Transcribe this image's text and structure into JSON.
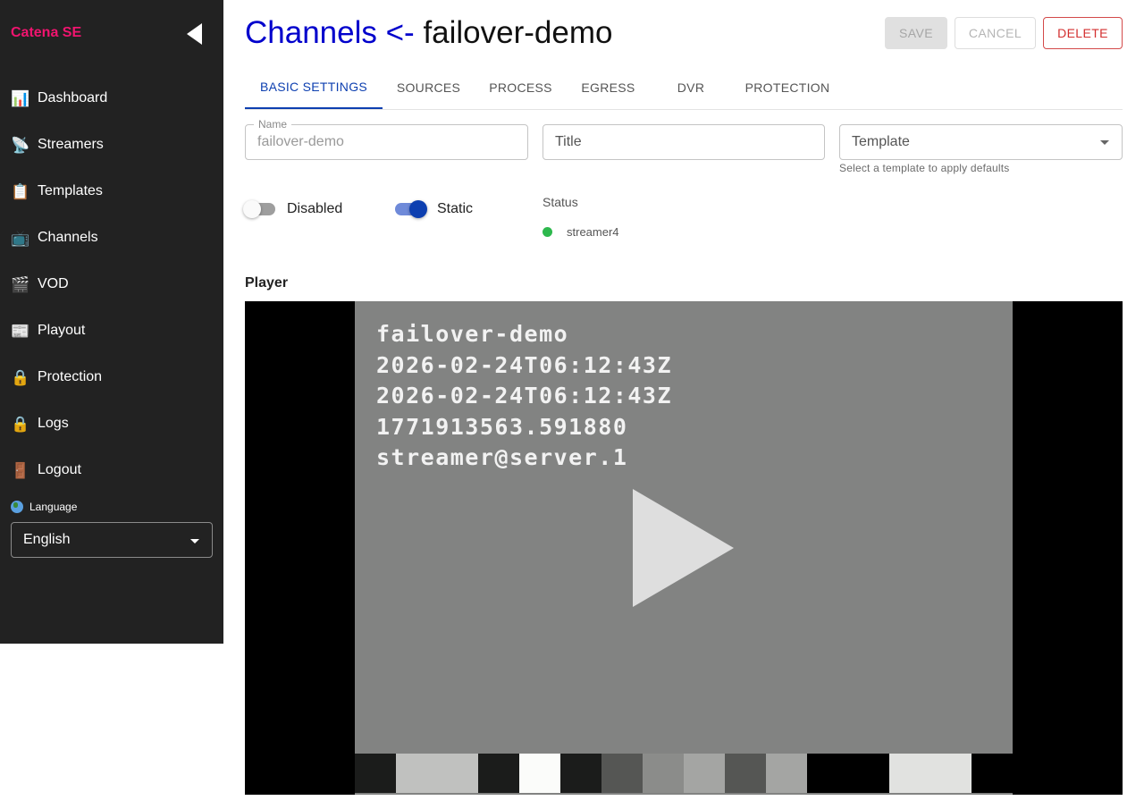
{
  "sidebar": {
    "brand": "Catena SE",
    "items": [
      {
        "label": "Dashboard",
        "icon": "📊"
      },
      {
        "label": "Streamers",
        "icon": "📡"
      },
      {
        "label": "Templates",
        "icon": "📋"
      },
      {
        "label": "Channels",
        "icon": "📺"
      },
      {
        "label": "VOD",
        "icon": "🎬"
      },
      {
        "label": "Playout",
        "icon": "📰"
      },
      {
        "label": "Protection",
        "icon": "🔒"
      },
      {
        "label": "Logs",
        "icon": "🔒"
      },
      {
        "label": "Logout",
        "icon": "🚪"
      }
    ],
    "language_label": "Language",
    "language_value": "English"
  },
  "header": {
    "crumb": "Channels <-",
    "name": "failover-demo",
    "save_label": "SAVE",
    "cancel_label": "CANCEL",
    "delete_label": "DELETE"
  },
  "tabs": [
    "BASIC SETTINGS",
    "SOURCES",
    "PROCESS",
    "EGRESS",
    "DVR",
    "PROTECTION"
  ],
  "form": {
    "name_label": "Name",
    "name_value": "failover-demo",
    "title_placeholder": "Title",
    "template_placeholder": "Template",
    "template_helper": "Select a template to apply defaults",
    "disabled_label": "Disabled",
    "static_label": "Static",
    "status_label": "Status",
    "status_value": "streamer4"
  },
  "player": {
    "heading": "Player",
    "overlay_lines": [
      "failover-demo",
      "2026-02-24T06:12:43Z",
      "2026-02-24T06:12:43Z",
      "1771913563.591880",
      "streamer@server.1"
    ],
    "bar_colors": [
      "#1b1c1b",
      "#c0c1bf",
      "#c0c1bf",
      "#1b1c1b",
      "#fbfcfa",
      "#1b1c1b",
      "#555654",
      "#8b8c8a",
      "#a4a5a3",
      "#555654",
      "#a4a5a3",
      "#000000",
      "#000000",
      "#e1e2e0",
      "#e1e2e0",
      "#000000"
    ]
  }
}
